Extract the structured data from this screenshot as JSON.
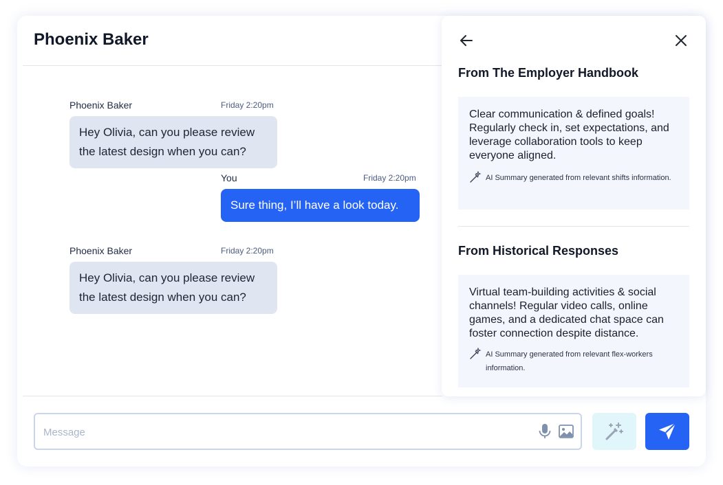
{
  "chat": {
    "title": "Phoenix Baker",
    "messages": [
      {
        "sender": "Phoenix Baker",
        "time": "Friday 2:20pm",
        "text": "Hey Olivia, can you please review the latest design when you can?"
      },
      {
        "sender": "You",
        "time": "Friday 2:20pm",
        "text": "Sure thing, I’ll have a look today."
      },
      {
        "sender": "Phoenix Baker",
        "time": "Friday 2:20pm",
        "text": "Hey Olivia, can you please review the latest design when you can?"
      }
    ]
  },
  "panel": {
    "back_icon": "arrow-left-icon",
    "close_icon": "close-icon",
    "sections": [
      {
        "title": "From The Employer Handbook",
        "summary": "Clear communication & defined goals! Regularly check in, set expectations, and leverage collaboration tools to keep everyone aligned.",
        "note": "AI Summary generated from relevant shifts information."
      },
      {
        "title": "From Historical Responses",
        "summary": "Virtual team-building activities & social channels! Regular video calls, online games, and a dedicated chat space can foster connection despite distance.",
        "note": "AI Summary generated from relevant flex-workers information."
      }
    ]
  },
  "composer": {
    "placeholder": "Message",
    "value": "",
    "icons": [
      "microphone-icon",
      "image-icon",
      "magic-wand-icon",
      "send-icon"
    ]
  },
  "colors": {
    "accent": "#2563f5",
    "incoming_bubble": "#e0e6f1",
    "summary_bg": "#f3f6fd",
    "magic_button_bg": "#e0f6fb"
  }
}
